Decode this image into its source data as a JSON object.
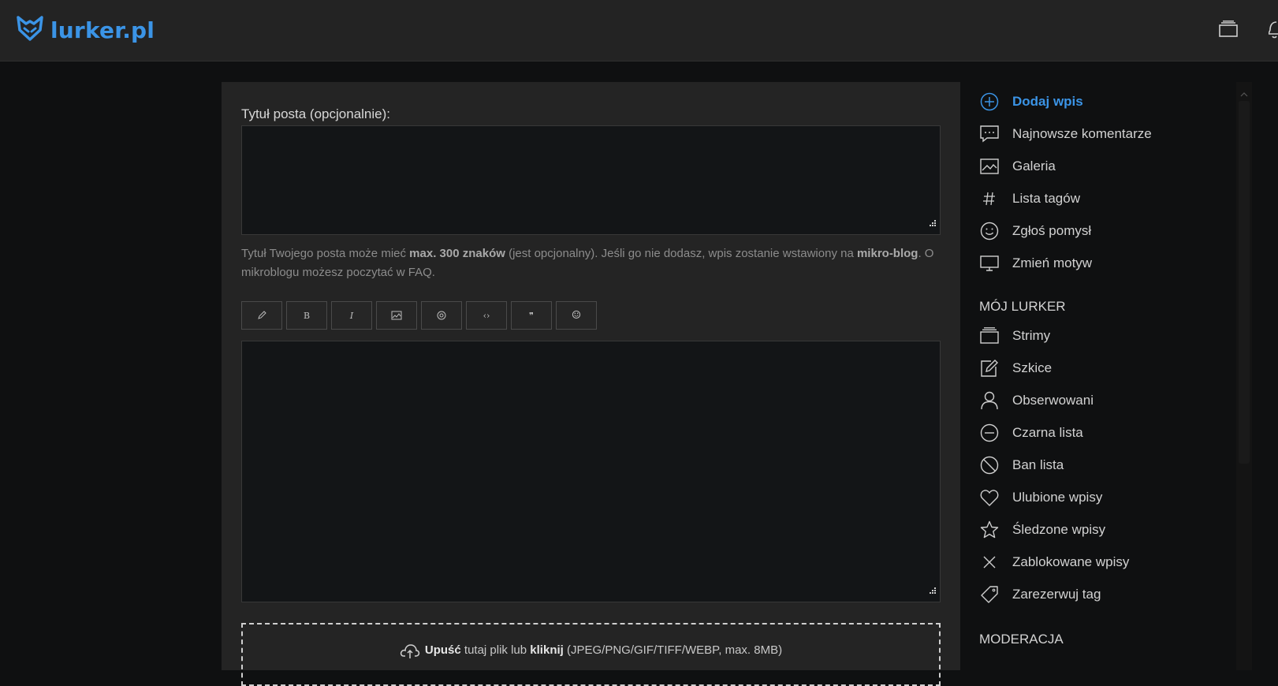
{
  "header": {
    "logo_text": "lurker.pl",
    "icons": [
      "streams-icon",
      "bell-icon"
    ]
  },
  "form": {
    "title_label": "Tytuł posta (opcjonalnie):",
    "title_value": "",
    "hint": {
      "p1": "Tytuł Twojego posta może mieć ",
      "b1": "max. 300 znaków",
      "p2": " (jest opcjonalny). Jeśli go nie dodasz, wpis zostanie wstawiony na ",
      "b2": "mikro-blog",
      "p3": ". O mikroblogu możesz poczytać w FAQ."
    },
    "toolbar": [
      {
        "name": "pencil-tool",
        "glyph": "✎"
      },
      {
        "name": "bold-tool",
        "glyph": "B"
      },
      {
        "name": "italic-tool",
        "glyph": "I"
      },
      {
        "name": "image-tool",
        "glyph": "▨"
      },
      {
        "name": "spoiler-tool",
        "glyph": "◎"
      },
      {
        "name": "code-tool",
        "glyph": "‹›"
      },
      {
        "name": "quote-tool",
        "glyph": "❞"
      },
      {
        "name": "emoji-tool",
        "glyph": "☺"
      }
    ],
    "body_value": "",
    "dropzone": {
      "drop_b": "Upuść",
      "text1": "tutaj plik lub",
      "click_b": "kliknij",
      "formats": "(JPEG/PNG/GIF/TIFF/WEBP, max. 8MB)"
    }
  },
  "sidebar": {
    "items": [
      {
        "label": "Dodaj wpis",
        "icon": "plus-circle-icon",
        "active": true
      },
      {
        "label": "Najnowsze komentarze",
        "icon": "comment-icon"
      },
      {
        "label": "Galeria",
        "icon": "image-icon"
      },
      {
        "label": "Lista tagów",
        "icon": "hash-icon"
      },
      {
        "label": "Zgłoś pomysł",
        "icon": "smile-icon"
      },
      {
        "label": "Zmień motyw",
        "icon": "monitor-icon"
      }
    ],
    "my_section_title": "MÓJ LURKER",
    "my_items": [
      {
        "label": "Strimy",
        "icon": "streams-icon"
      },
      {
        "label": "Szkice",
        "icon": "edit-icon"
      },
      {
        "label": "Obserwowani",
        "icon": "user-icon"
      },
      {
        "label": "Czarna lista",
        "icon": "minus-circle-icon"
      },
      {
        "label": "Ban lista",
        "icon": "ban-icon"
      },
      {
        "label": "Ulubione wpisy",
        "icon": "heart-icon"
      },
      {
        "label": "Śledzone wpisy",
        "icon": "star-icon"
      },
      {
        "label": "Zablokowane wpisy",
        "icon": "x-icon"
      },
      {
        "label": "Zarezerwuj tag",
        "icon": "tag-icon"
      }
    ],
    "moderation_title": "MODERACJA"
  },
  "colors": {
    "accent": "#3b94e6",
    "background": "#0f1011",
    "panel": "#242424",
    "topbar": "#232323"
  }
}
